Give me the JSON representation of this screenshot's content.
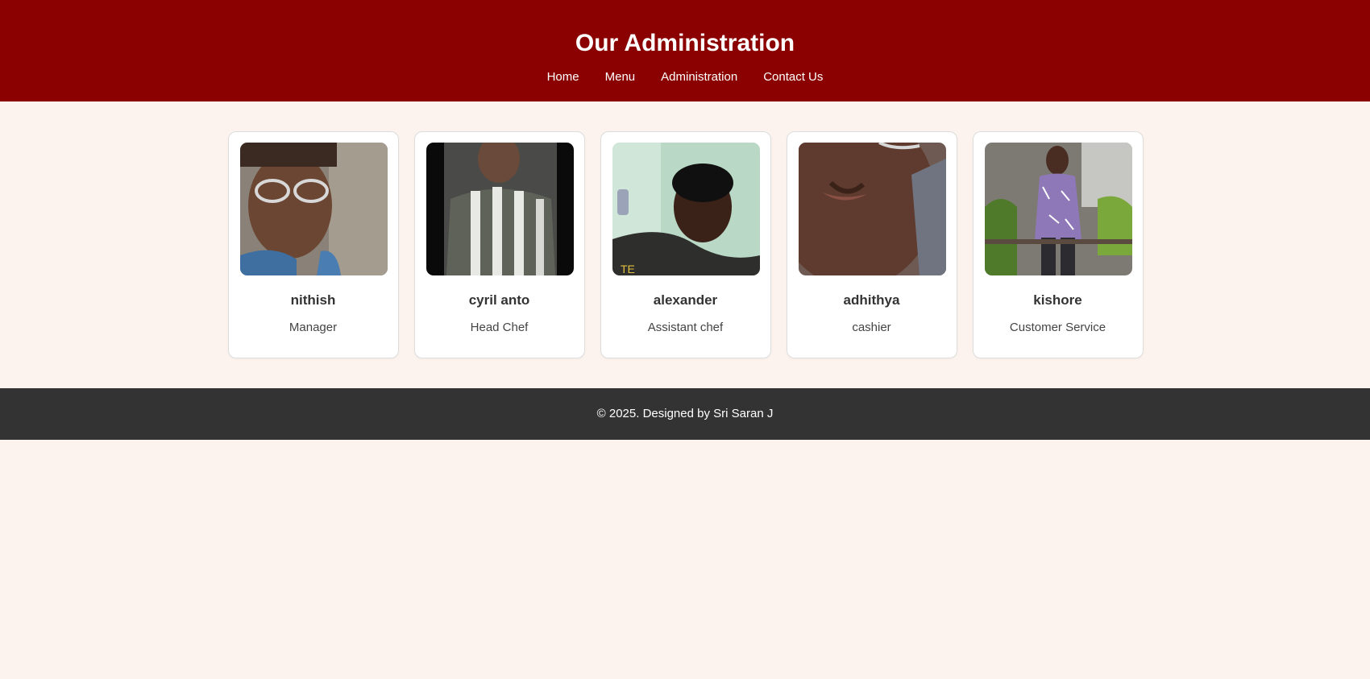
{
  "header": {
    "title": "Our Administration",
    "nav": [
      "Home",
      "Menu",
      "Administration",
      "Contact Us"
    ]
  },
  "staff": [
    {
      "name": "nithish",
      "role": "Manager"
    },
    {
      "name": "cyril anto",
      "role": "Head Chef"
    },
    {
      "name": "alexander",
      "role": "Assistant chef"
    },
    {
      "name": "adhithya",
      "role": "cashier"
    },
    {
      "name": "kishore",
      "role": "Customer Service"
    }
  ],
  "footer": {
    "text": "© 2025. Designed by Sri Saran J"
  },
  "colors": {
    "header_bg": "#8b0000",
    "page_bg": "#fdf3ee",
    "footer_bg": "#333333"
  }
}
